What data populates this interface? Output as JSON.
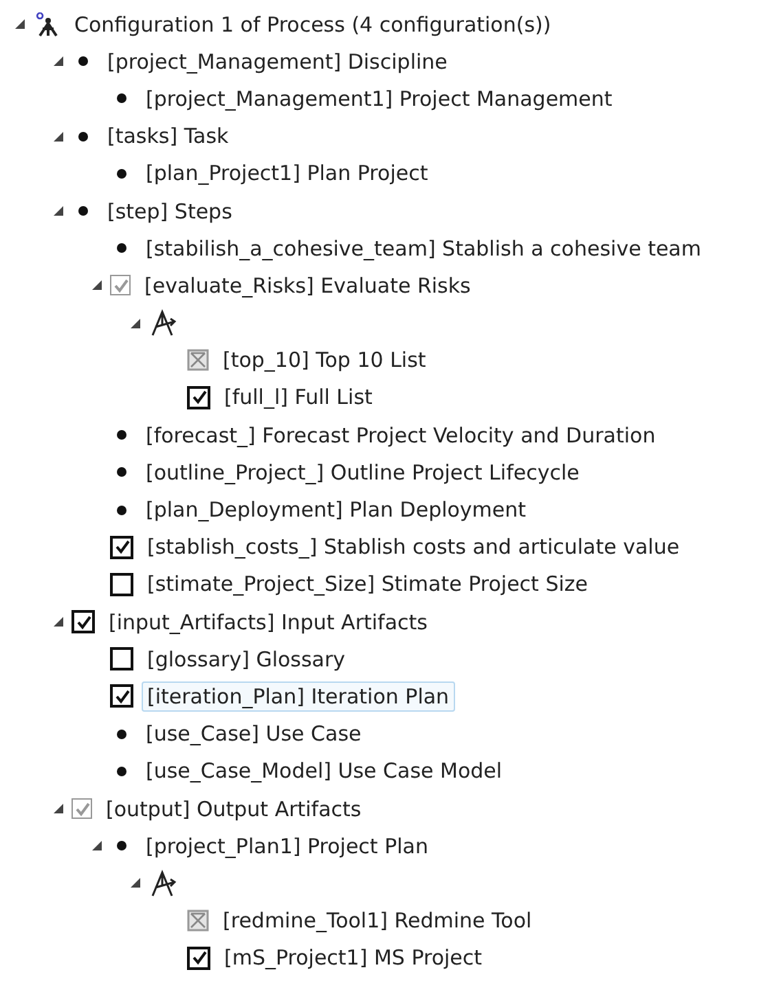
{
  "tree": {
    "kind": "configuration",
    "label": "Configuration 1 of Process (4 configuration(s))",
    "expanded": true,
    "selected": false,
    "children": [
      {
        "kind": "element",
        "label": "[project_Management] Discipline",
        "expanded": true,
        "selected": false,
        "children": [
          {
            "kind": "element",
            "label": "[project_Management1] Project Management",
            "selected": false
          }
        ]
      },
      {
        "kind": "element",
        "label": "[tasks] Task",
        "expanded": true,
        "selected": false,
        "children": [
          {
            "kind": "element",
            "label": "[plan_Project1] Plan Project",
            "selected": false
          }
        ]
      },
      {
        "kind": "element",
        "label": "[step] Steps",
        "expanded": true,
        "selected": false,
        "children": [
          {
            "kind": "element",
            "label": "[stabilish_a_cohesive_team] Stablish a cohesive team",
            "selected": false
          },
          {
            "kind": "checkbox",
            "label": "[evaluate_Risks] Evaluate Risks",
            "checked": true,
            "greyed": true,
            "expanded": true,
            "selected": false,
            "children": [
              {
                "kind": "variability",
                "expanded": true,
                "selected": false,
                "children": [
                  {
                    "kind": "excluded",
                    "label": "[top_10] Top 10 List",
                    "selected": false
                  },
                  {
                    "kind": "checkbox",
                    "label": "[full_l] Full List",
                    "checked": true,
                    "greyed": false,
                    "selected": false
                  }
                ]
              }
            ]
          },
          {
            "kind": "element",
            "label": "[forecast_] Forecast Project Velocity and Duration",
            "selected": false
          },
          {
            "kind": "element",
            "label": "[outline_Project_] Outline Project Lifecycle",
            "selected": false
          },
          {
            "kind": "element",
            "label": "[plan_Deployment] Plan Deployment",
            "selected": false
          },
          {
            "kind": "checkbox",
            "label": "[stablish_costs_] Stablish costs and articulate value",
            "checked": true,
            "greyed": false,
            "selected": false
          },
          {
            "kind": "checkbox",
            "label": "[stimate_Project_Size] Stimate Project Size",
            "checked": false,
            "greyed": false,
            "selected": false
          }
        ]
      },
      {
        "kind": "checkbox",
        "label": "[input_Artifacts] Input Artifacts",
        "checked": true,
        "greyed": false,
        "expanded": true,
        "selected": false,
        "children": [
          {
            "kind": "checkbox",
            "label": "[glossary] Glossary",
            "checked": false,
            "greyed": false,
            "selected": false
          },
          {
            "kind": "checkbox",
            "label": "[iteration_Plan] Iteration Plan",
            "checked": true,
            "greyed": false,
            "selected": true
          },
          {
            "kind": "element",
            "label": "[use_Case] Use Case",
            "selected": false
          },
          {
            "kind": "element",
            "label": "[use_Case_Model] Use Case Model",
            "selected": false
          }
        ]
      },
      {
        "kind": "checkbox",
        "label": "[output] Output Artifacts",
        "checked": true,
        "greyed": true,
        "expanded": true,
        "selected": false,
        "children": [
          {
            "kind": "element",
            "label": "[project_Plan1] Project Plan",
            "expanded": true,
            "selected": false,
            "children": [
              {
                "kind": "variability",
                "expanded": true,
                "selected": false,
                "children": [
                  {
                    "kind": "excluded",
                    "label": "[redmine_Tool1] Redmine Tool",
                    "selected": false
                  },
                  {
                    "kind": "checkbox",
                    "label": "[mS_Project1] MS Project",
                    "checked": true,
                    "greyed": false,
                    "selected": false
                  }
                ]
              }
            ]
          }
        ]
      }
    ]
  }
}
